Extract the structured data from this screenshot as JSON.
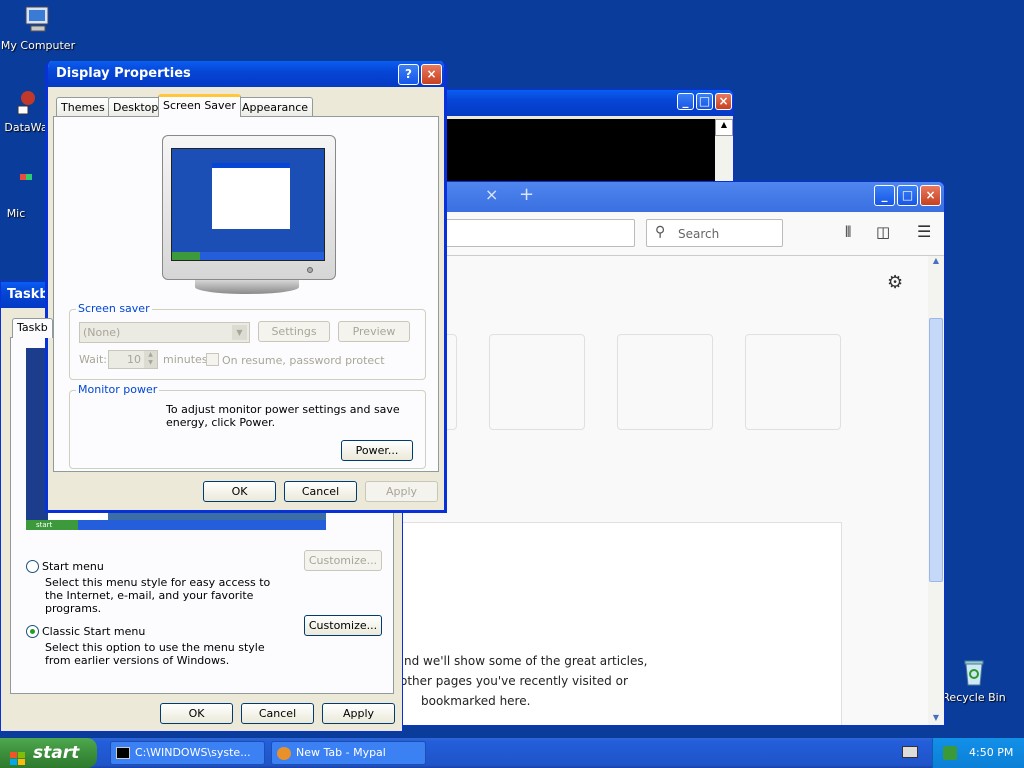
{
  "desktop": {
    "icons": {
      "my_computer": "My Computer",
      "datawa": "DataWa",
      "mic": "Mic",
      "recycle_bin": "Recycle Bin"
    }
  },
  "display_properties": {
    "title": "Display Properties",
    "tabs": [
      "Themes",
      "Desktop",
      "Screen Saver",
      "Appearance"
    ],
    "active_tab": "Screen Saver",
    "screen_saver_group": {
      "label": "Screen saver",
      "selected": "(None)",
      "settings_label": "Settings",
      "preview_label": "Preview",
      "wait_label": "Wait:",
      "wait_value": "10",
      "minutes_label": "minutes",
      "resume_label": "On resume, password protect"
    },
    "monitor_power_group": {
      "label": "Monitor power",
      "text": "To adjust monitor power settings and save energy, click Power.",
      "power_label": "Power..."
    },
    "ok_label": "OK",
    "cancel_label": "Cancel",
    "apply_label": "Apply"
  },
  "taskbar_props": {
    "title": "Taskb",
    "tab": "Taskb",
    "start_menu": {
      "label": "Start menu",
      "desc": "Select this menu style for easy access to the Internet, e-mail, and your favorite programs.",
      "customize_label": "Customize..."
    },
    "classic_start_menu": {
      "label": "Classic Start menu",
      "desc": "Select this option to use the menu style from earlier versions of Windows.",
      "customize_label": "Customize..."
    },
    "preview_start": "start",
    "ok_label": "OK",
    "cancel_label": "Cancel",
    "apply_label": "Apply"
  },
  "firefox": {
    "search_placeholder": "Search",
    "tab_close": "×",
    "new_tab": "+",
    "snippet_lines": [
      "nd we'll show some of the great articles,",
      "other pages you've recently visited or",
      "bookmarked here."
    ]
  },
  "taskbar": {
    "start_label": "start",
    "items": [
      "C:\\WINDOWS\\syste...",
      "New Tab - Mypal"
    ],
    "clock": "4:50 PM"
  },
  "colors": {
    "desktop": "#0a3c9c",
    "xp_title": "#0646d6",
    "group_label": "#0046d5"
  }
}
